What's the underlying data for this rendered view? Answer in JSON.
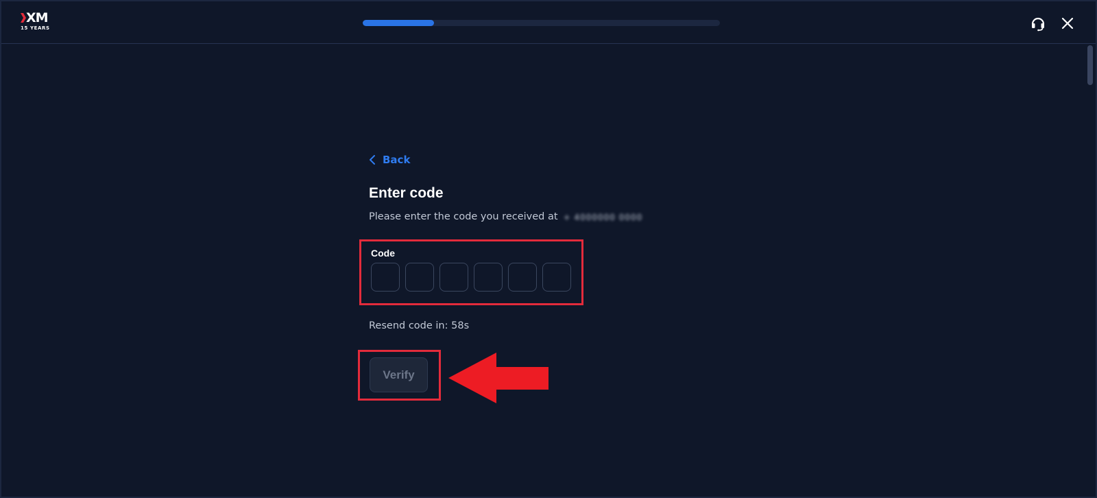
{
  "header": {
    "logo_text": "XM",
    "logo_caption": "15 YEARS",
    "progress_fraction": 0.2,
    "support_icon": "headset-icon",
    "close_icon": "close-icon"
  },
  "form": {
    "back_label": "Back",
    "title": "Enter code",
    "subtitle": "Please enter the code you received at",
    "masked_contact": "+ 4000000 0000",
    "code_label": "Code",
    "code_digits": [
      "",
      "",
      "",
      "",
      "",
      ""
    ],
    "resend_text": "Resend code in: 58s",
    "verify_label": "Verify"
  },
  "colors": {
    "background": "#0f1729",
    "accent": "#2a74e6",
    "highlight": "#e32b3b"
  }
}
